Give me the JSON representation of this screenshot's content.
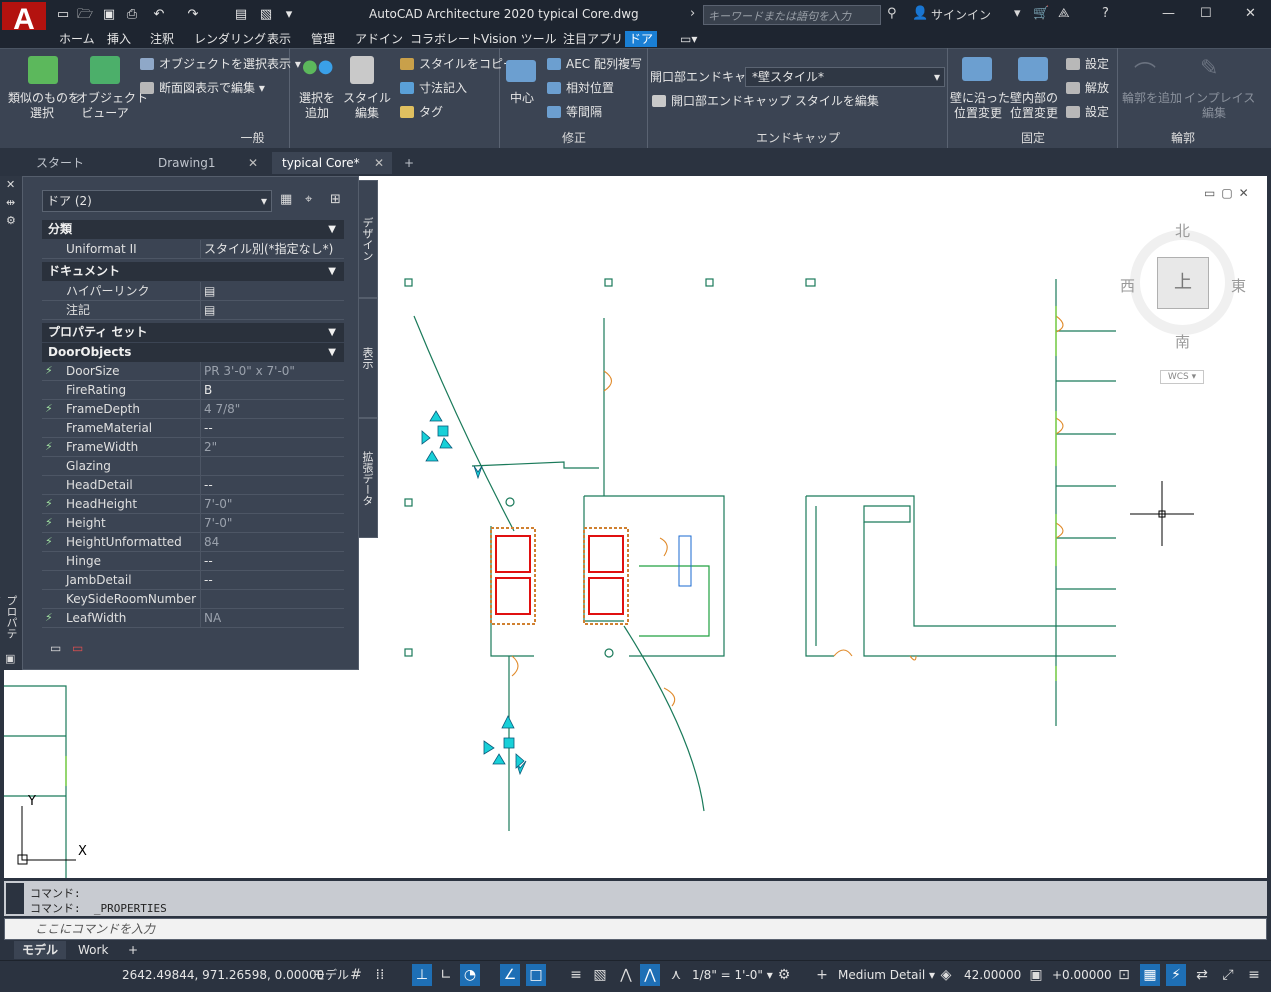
{
  "titlebar": {
    "app_title": "AutoCAD Architecture 2020    typical Core.dwg",
    "search_placeholder": "キーワードまたは語句を入力",
    "signin": "サインイン",
    "logo": "A"
  },
  "ribbon_tabs": [
    "ホーム",
    "挿入",
    "注釈",
    "レンダリング",
    "表示",
    "管理",
    "アドイン",
    "コラボレート",
    "Vision ツール",
    "注目アプリ",
    "ドア"
  ],
  "ribbon": {
    "general": {
      "label": "一般",
      "select_similar": [
        "類似のものを",
        "選択"
      ],
      "object_viewer": [
        "オブジェクト",
        "ビューア"
      ],
      "isolate_objects": "オブジェクトを選択表示",
      "edit_in_section": "断面図表示で編集"
    },
    "add_select": [
      "選択を",
      "追加"
    ],
    "style_edit": [
      "スタイル",
      "編集"
    ],
    "modify": {
      "label": "修正",
      "copy_style": "スタイルをコピー",
      "add_dimension": "寸法記入",
      "tag": "タグ",
      "center": "中心",
      "aec_array": "AEC 配列複写",
      "relative_position": "相対位置",
      "equal_spacing": "等間隔"
    },
    "endcap": {
      "label": "エンドキャップ",
      "opening_endcap_label": "開口部エンドキャップ",
      "style_value": "*壁スタイル*",
      "edit_style": "開口部エンドキャップ スタイルを編集"
    },
    "anchor": {
      "label": "固定",
      "along_wall": [
        "壁に沿った",
        "位置変更"
      ],
      "within_wall": [
        "壁内部の",
        "位置変更"
      ],
      "set1": "設定",
      "release": "解放",
      "set2": "設定"
    },
    "profile": {
      "label": "輪郭",
      "add_profile": [
        "輪郭を追加"
      ],
      "in_place_edit": [
        "インプレイス",
        "編集"
      ]
    }
  },
  "doc_tabs": [
    {
      "label": "スタート"
    },
    {
      "label": "Drawing1"
    },
    {
      "label": "typical Core*"
    }
  ],
  "properties": {
    "selection": "ドア (2)",
    "side_tabs": [
      "デザイン",
      "表示",
      "拡張データ"
    ],
    "palette_title": "プロパティ",
    "sections": {
      "classification": "分類",
      "document": "ドキュメント",
      "property_sets": "プロパティ セット",
      "door_objects": "DoorObjects"
    },
    "classification_rows": [
      {
        "name": "Uniformat II",
        "value": "スタイル別(*指定なし*)"
      }
    ],
    "document_rows": [
      {
        "name": "ハイパーリンク",
        "value": ""
      },
      {
        "name": "注記",
        "value": ""
      }
    ],
    "door_rows": [
      {
        "name": "DoorSize",
        "value": "PR 3'-0\" x 7'-0\"",
        "bolt": true
      },
      {
        "name": "FireRating",
        "value": "B",
        "bolt": false
      },
      {
        "name": "FrameDepth",
        "value": "4 7/8\"",
        "bolt": true
      },
      {
        "name": "FrameMaterial",
        "value": "--",
        "bolt": false
      },
      {
        "name": "FrameWidth",
        "value": "2\"",
        "bolt": true
      },
      {
        "name": "Glazing",
        "value": "",
        "bolt": false
      },
      {
        "name": "HeadDetail",
        "value": "--",
        "bolt": false
      },
      {
        "name": "HeadHeight",
        "value": "7'-0\"",
        "bolt": true
      },
      {
        "name": "Height",
        "value": "7'-0\"",
        "bolt": true
      },
      {
        "name": "HeightUnformatted",
        "value": "84",
        "bolt": true
      },
      {
        "name": "Hinge",
        "value": "--",
        "bolt": false
      },
      {
        "name": "JambDetail",
        "value": "--",
        "bolt": false
      },
      {
        "name": "KeySideRoomNumber",
        "value": "",
        "bolt": false
      },
      {
        "name": "LeafWidth",
        "value": "NA",
        "bolt": true
      }
    ]
  },
  "viewcube": {
    "north": "北",
    "south": "南",
    "east": "東",
    "west": "西",
    "face": "上",
    "wcs": "WCS"
  },
  "ucs": {
    "x": "X",
    "y": "Y"
  },
  "command": {
    "line1": "コマンド:",
    "line2": "コマンド:  _PROPERTIES",
    "placeholder": "ここにコマンドを入力"
  },
  "layout_tabs": [
    "モデル",
    "Work"
  ],
  "status": {
    "coords": "2642.49844, 971.26598, 0.00000",
    "model": "モデル",
    "scale": "1/8\" = 1'-0\"",
    "detail": "Medium Detail",
    "elevation": "42.00000",
    "offset": "+0.00000"
  }
}
